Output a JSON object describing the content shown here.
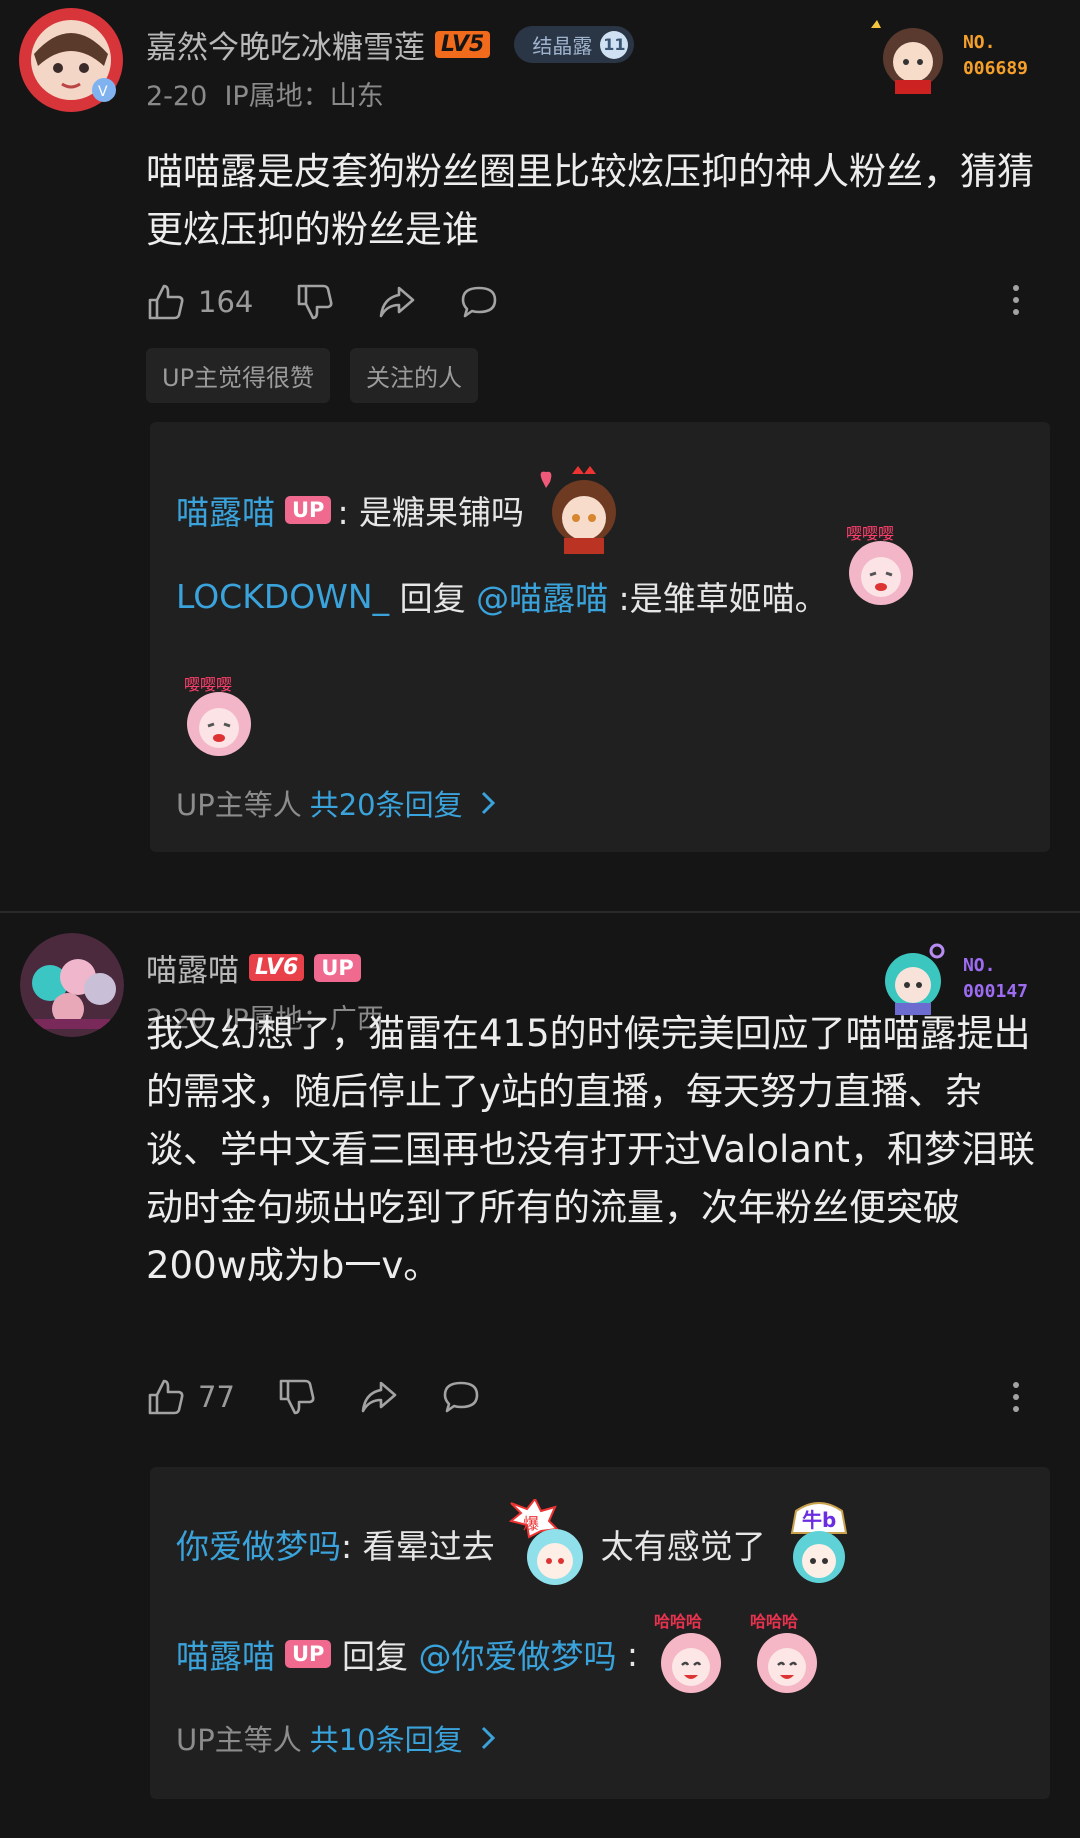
{
  "comments": [
    {
      "username": "嘉然今晚吃冰糖雪莲",
      "level": "LV5",
      "fan_badge": {
        "name": "结晶露",
        "level": "11"
      },
      "date": "2-20",
      "ip": "IP属地：山东",
      "collect_no_label": "NO.",
      "collect_no": "006689",
      "collect_color": "#f5a02a",
      "text": "喵喵露是皮套狗粉丝圈里比较炫压抑的神人粉丝，猜猜更炫压抑的粉丝是谁",
      "likes": "164",
      "tags": [
        "UP主觉得很赞",
        "关注的人"
      ],
      "replies": {
        "r1_user": "喵露喵",
        "r1_tag": "UP",
        "r1_text": ": 是糖果铺吗",
        "r2_user": "LOCKDOWN_",
        "r2_mid": " 回复 ",
        "r2_mention": "@喵露喵",
        "r2_text": " :是雏草姬喵。",
        "more_prefix": "UP主等人",
        "more_count": "共20条回复"
      }
    },
    {
      "username": "喵露喵",
      "level": "LV6",
      "up_tag": "UP",
      "date": "2-20",
      "ip": "IP属地：广西",
      "collect_no_label": "NO.",
      "collect_no": "000147",
      "collect_color": "#9d6cf2",
      "text": "我又幻想了，猫雷在415的时候完美回应了喵喵露提出的需求，随后停止了y站的直播，每天努力直播、杂谈、学中文看三国再也没有打开过Valolant，和梦泪联动时金句频出吃到了所有的流量，次年粉丝便突破200w成为b一v。",
      "likes": "77",
      "replies": {
        "r1_user": "你爱做梦吗",
        "r1_text": ": 看晕过去",
        "r1_text2": "太有感觉了",
        "sticker1_text": "爆",
        "sticker2_text": "牛b",
        "r2_user": "喵露喵",
        "r2_tag": "UP",
        "r2_mid": " 回复 ",
        "r2_mention": "@你爱做梦吗",
        "r2_text": " :",
        "sticker_haha": "哈哈哈",
        "more_prefix": "UP主等人",
        "more_count": "共10条回复"
      }
    }
  ]
}
